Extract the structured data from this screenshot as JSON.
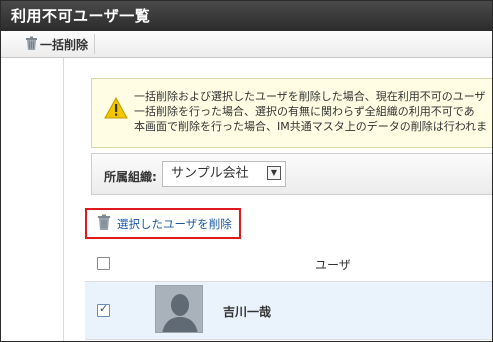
{
  "window": {
    "title": "利用不可ユーザ一覧"
  },
  "toolbar": {
    "bulk_delete_label": "一括削除"
  },
  "notice": {
    "lines": [
      "一括削除および選択したユーザを削除した場合、現在利用不可のユーザ",
      "一括削除を行った場合、選択の有無に関わらず全組織の利用不可であ",
      "本画面で削除を行った場合、IM共通マスタ上のデータの削除は行われま"
    ]
  },
  "filter": {
    "label": "所属組織:",
    "selected": "サンプル会社"
  },
  "actions": {
    "delete_selected_label": "選択したユーザを削除"
  },
  "table": {
    "header": {
      "user": "ユーザ"
    },
    "rows": [
      {
        "name": "吉川一哉",
        "checked": true
      }
    ]
  }
}
